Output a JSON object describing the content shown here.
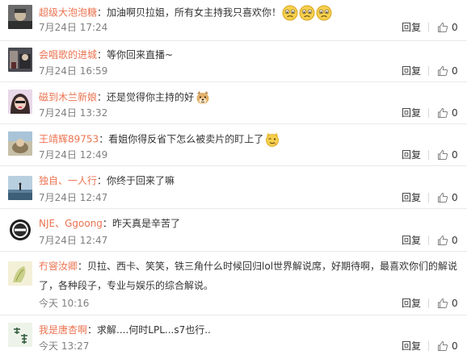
{
  "comments": [
    {
      "user": "超级大泡泡糖",
      "text": "加油啊贝拉姐，所有女主持我只喜欢你！",
      "emoji": [
        "sad-face-icon",
        "sad-face-icon",
        "sad-face-icon"
      ],
      "time": "7月24日 17:24",
      "reply": "回复",
      "like": "0"
    },
    {
      "user": "会唱歌的进城",
      "text": "等你回来直播~",
      "time": "7月24日 16:59",
      "reply": "回复",
      "like": "0"
    },
    {
      "user": "磁到木兰新娘",
      "text": "还是觉得你主持的好",
      "emoji": [
        "doge-icon"
      ],
      "time": "7月24日 13:32",
      "reply": "回复",
      "like": "0"
    },
    {
      "user": "王靖辉89753",
      "text": "看姐你得反省下怎么被卖片的盯上了",
      "emoji": [
        "wink-cat-icon"
      ],
      "time": "7月24日 12:49",
      "reply": "回复",
      "like": "0"
    },
    {
      "user": "独自、一人行",
      "text": "你终于回来了嘛",
      "time": "7月24日 12:47",
      "reply": "回复",
      "like": "0"
    },
    {
      "user": "NJE、Ggoong",
      "text": "昨天真是辛苦了",
      "time": "7月24日 12:47",
      "reply": "回复",
      "like": "0"
    },
    {
      "user": "冇窨汝卿",
      "text": "贝拉、西卡、笑笑，铁三角什么时候回归lol世界解说席，好期待啊，最喜欢你们的解说",
      "text2": "了，各种段子，专业与娱乐的综合解说。",
      "time": "今天 10:16",
      "reply": "回复",
      "like": "0"
    },
    {
      "user": "我是唐杏啊",
      "text": "求解....何时LPL...s7也行..",
      "time": "今天 13:27",
      "reply": "回复",
      "like": "0"
    }
  ]
}
